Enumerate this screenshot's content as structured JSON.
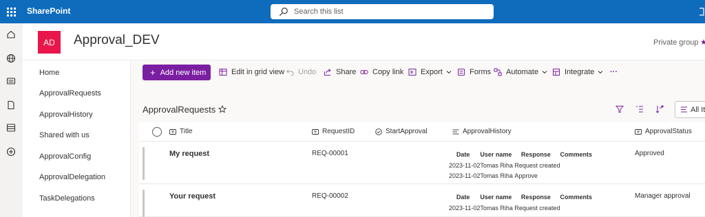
{
  "suite": {
    "brand": "SharePoint",
    "search_placeholder": "Search this list"
  },
  "site": {
    "logo_text": "AD",
    "title": "Approval_DEV",
    "privacy": "Private group"
  },
  "nav": {
    "items": [
      {
        "label": "Home"
      },
      {
        "label": "ApprovalRequests"
      },
      {
        "label": "ApprovalHistory"
      },
      {
        "label": "Shared with us"
      },
      {
        "label": "ApprovalConfig"
      },
      {
        "label": "ApprovalDelegation"
      },
      {
        "label": "TaskDelegations"
      }
    ]
  },
  "toolbar": {
    "new_label": "Add new item",
    "grid_view": "Edit in grid view",
    "undo": "Undo",
    "share": "Share",
    "copy_link": "Copy link",
    "export": "Export",
    "forms": "Forms",
    "automate": "Automate",
    "integrate": "Integrate",
    "more": "···"
  },
  "list": {
    "title": "ApprovalRequests",
    "view_label": "All Items"
  },
  "columns": {
    "title": "Title",
    "request_id": "RequestID",
    "start_approval": "StartApproval",
    "approval_history": "ApprovalHistory",
    "approval_status": "ApprovalStatus"
  },
  "history_headers": {
    "date": "Date",
    "user": "User name",
    "response": "Response",
    "comments": "Comments"
  },
  "rows": [
    {
      "title": "My request",
      "request_id": "REQ-00001",
      "status": "Approved",
      "history": [
        {
          "date": "2023-11-02",
          "user": "Tomas Riha",
          "response": "Request created"
        },
        {
          "date": "2023-11-02",
          "user": "Tomas Riha",
          "response": "Approve"
        }
      ]
    },
    {
      "title": "Your request",
      "request_id": "REQ-00002",
      "status": "Manager approval",
      "history": [
        {
          "date": "2023-11-02",
          "user": "Tomas Riha",
          "response": "Request created"
        }
      ]
    }
  ],
  "colors": {
    "suite_bar": "#0f6cbd",
    "primary_button": "#7b1fa2",
    "site_logo": "#e8164b"
  }
}
